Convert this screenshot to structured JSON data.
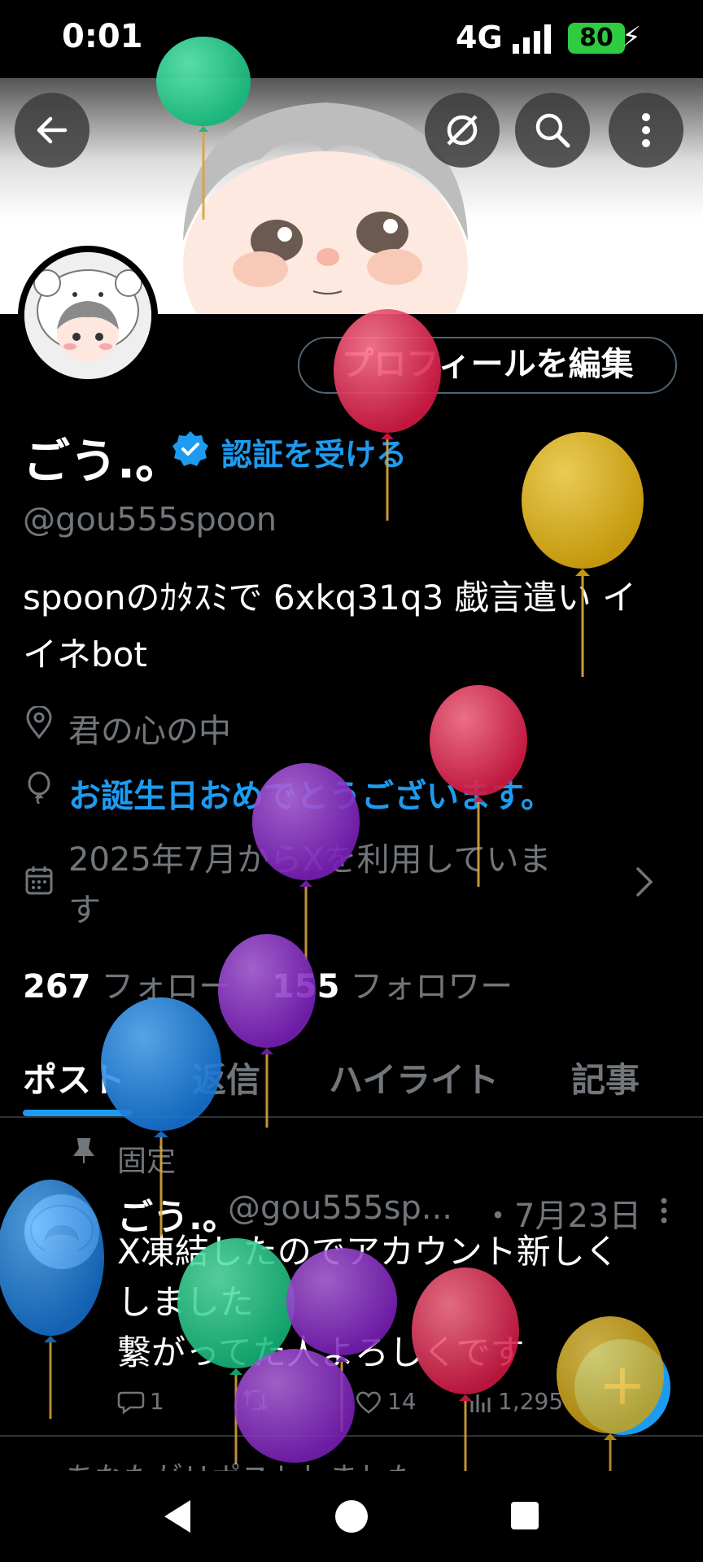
{
  "status_bar": {
    "time": "0:01",
    "network": "4G",
    "battery": "80"
  },
  "header": {
    "back_icon": "arrow-left-icon",
    "grok_icon": "grok-icon",
    "search_icon": "search-icon",
    "more_icon": "more-vertical-icon"
  },
  "profile": {
    "edit_button": "プロフィールを編集",
    "name": "ごう.。",
    "verify_label": "認証を受ける",
    "handle": "@gou555spoon",
    "bio_line1": "spoonのｶﾀｽﾐで 6xkq31q3  戯言遣い イ",
    "bio_line2": "イネbot",
    "location": "君の心の中",
    "birthday": "お誕生日おめでとうございます。",
    "joined_line1": "2025年7月からXを利用していま",
    "joined_line2": "す",
    "following_count": "267",
    "following_label": "フォロー",
    "followers_count": "155",
    "followers_label": "フォロワー"
  },
  "tabs": [
    "ポスト",
    "返信",
    "ハイライト",
    "記事"
  ],
  "pinned_tweet": {
    "pinned_label": "固定",
    "author": "ごう.。",
    "handle": "@gou555sp...",
    "date": "・7月23日",
    "lines": [
      "X凍結したのでアカウント新しく",
      "しました",
      "繋がってた人よろしくです"
    ],
    "replies": "1",
    "likes": "14",
    "views": "1,295"
  },
  "retweet_note": "あなたがリポストしました",
  "fab_label": "+",
  "colors": {
    "accent": "#1d9bf0",
    "background": "#000000",
    "secondary_text": "#71767b"
  }
}
